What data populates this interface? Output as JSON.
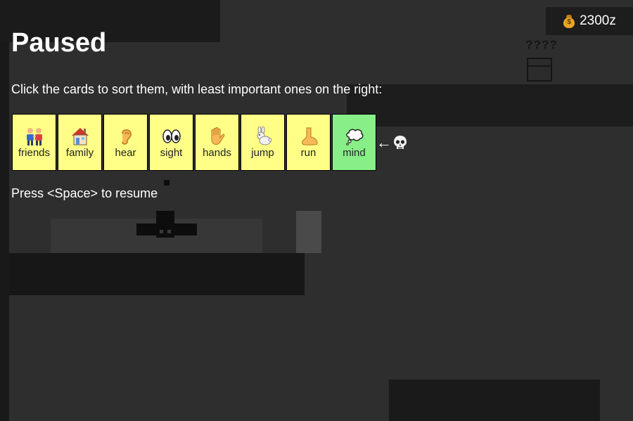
{
  "hud": {
    "money": "2300z",
    "money_icon": "money-bag-icon"
  },
  "world": {
    "chest_label": "????"
  },
  "pause": {
    "title": "Paused",
    "instruction": "Click the cards to sort them, with least important ones on the right:",
    "resume_hint": "Press <Space> to resume"
  },
  "cards": [
    {
      "label": "friends",
      "icon": "people-icon",
      "selected": false
    },
    {
      "label": "family",
      "icon": "house-icon",
      "selected": false
    },
    {
      "label": "hear",
      "icon": "ear-icon",
      "selected": false
    },
    {
      "label": "sight",
      "icon": "eyes-icon",
      "selected": false
    },
    {
      "label": "hands",
      "icon": "hand-icon",
      "selected": false
    },
    {
      "label": "jump",
      "icon": "rabbit-icon",
      "selected": false
    },
    {
      "label": "run",
      "icon": "foot-icon",
      "selected": false
    },
    {
      "label": "mind",
      "icon": "thought-bubble-icon",
      "selected": true
    }
  ],
  "sort_indicator": {
    "arrow": "←",
    "icon": "skull-icon"
  },
  "colors": {
    "card": "#ffff88",
    "card_selected": "#88ee88",
    "background": "#2e2e2e"
  }
}
